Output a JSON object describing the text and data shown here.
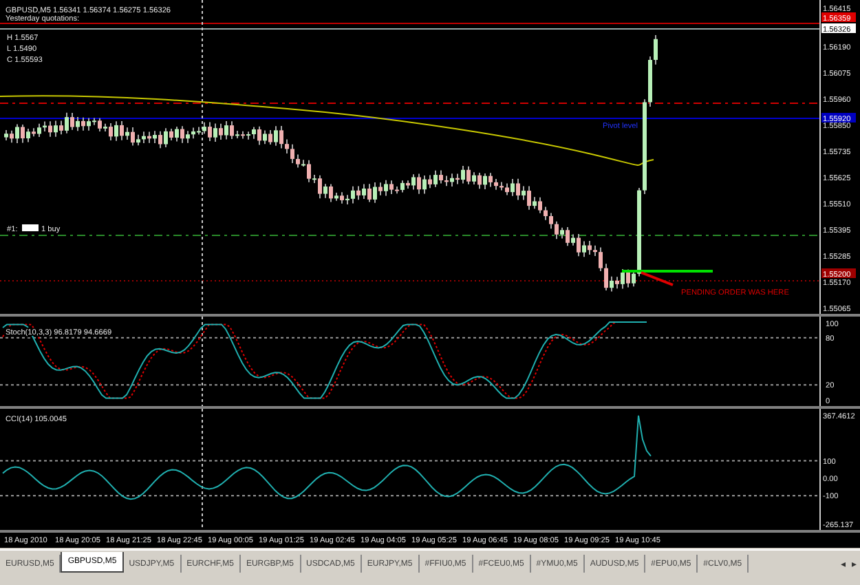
{
  "chart": {
    "symbol_info": "GBPUSD,M5  1.56341 1.56374 1.56275 1.56326",
    "yesterday_title": "Yesterday quotations:",
    "yesterday_lines": [
      "H 1.5567",
      "L 1.5490",
      "C 1.55593"
    ],
    "order_label": {
      "prefix": "#1:",
      "suffix": "1 buy"
    },
    "pivot_label": "Pivot level",
    "pending_note": "PENDING ORDER WAS HERE",
    "price_ticks": [
      "1.56415",
      "1.56190",
      "1.56075",
      "1.55960",
      "1.55850",
      "1.55735",
      "1.55625",
      "1.55510",
      "1.55395",
      "1.55285",
      "1.55170",
      "1.55065"
    ],
    "price_tags": [
      {
        "text": "1.56359",
        "color": "#e00000"
      },
      {
        "text": "1.56326",
        "color": "#ffffff"
      },
      {
        "text": "1.55920",
        "color": "#0000c0"
      },
      {
        "text": "1.55200",
        "color": "#a00000"
      }
    ]
  },
  "stochastic": {
    "title": "Stoch(10,3,3) 96.8179 94.6669",
    "axis": [
      "100",
      "80",
      "20",
      "0"
    ]
  },
  "cci": {
    "title": "CCI(14) 105.0045",
    "axis": [
      "367.4612",
      "100",
      "0.00",
      "-100",
      "-265.137"
    ]
  },
  "time_axis": [
    "18 Aug 2010",
    "18 Aug 20:05",
    "18 Aug 21:25",
    "18 Aug 22:45",
    "19 Aug 00:05",
    "19 Aug 01:25",
    "19 Aug 02:45",
    "19 Aug 04:05",
    "19 Aug 05:25",
    "19 Aug 06:45",
    "19 Aug 08:05",
    "19 Aug 09:25",
    "19 Aug 10:45"
  ],
  "tabs": [
    {
      "label": "EURUSD,M5",
      "selected": false
    },
    {
      "label": "GBPUSD,M5",
      "selected": true
    },
    {
      "label": "USDJPY,M5",
      "selected": false
    },
    {
      "label": "EURCHF,M5",
      "selected": false
    },
    {
      "label": "EURGBP,M5",
      "selected": false
    },
    {
      "label": "USDCAD,M5",
      "selected": false
    },
    {
      "label": "EURJPY,M5",
      "selected": false
    },
    {
      "label": "#FFIU0,M5",
      "selected": false
    },
    {
      "label": "#FCEU0,M5",
      "selected": false
    },
    {
      "label": "#YMU0,M5",
      "selected": false
    },
    {
      "label": "AUDUSD,M5",
      "selected": false
    },
    {
      "label": "#EPU0,M5",
      "selected": false
    },
    {
      "label": "#CLV0,M5",
      "selected": false
    }
  ],
  "tab_scroll": [
    "◂",
    "▸"
  ]
}
